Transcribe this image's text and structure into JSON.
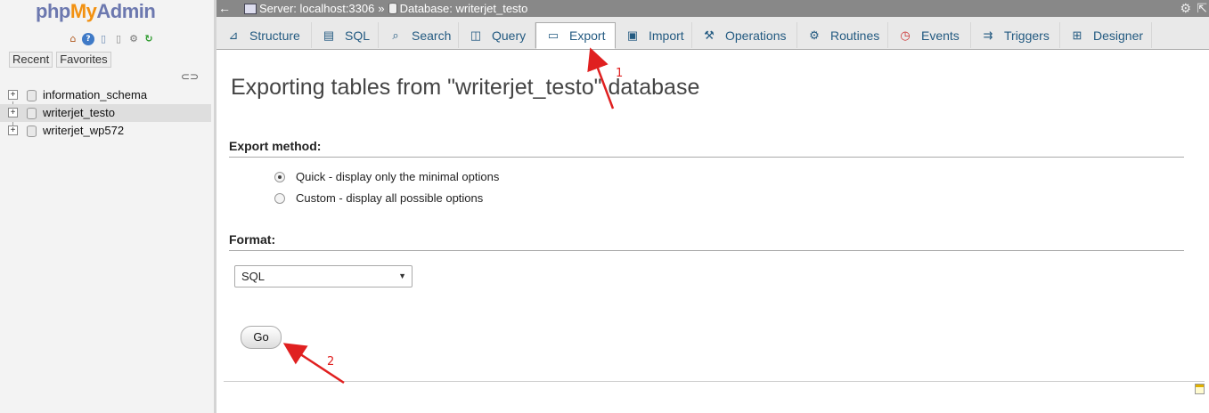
{
  "sidebar": {
    "logo": {
      "php": "php",
      "my": "My",
      "admin": "Admin"
    },
    "icons": [
      "home-icon",
      "help-icon",
      "docs-icon",
      "sql-docs-icon",
      "settings-icon",
      "reload-icon"
    ],
    "tabs": {
      "recent": "Recent",
      "favorites": "Favorites"
    },
    "databases": [
      {
        "name": "information_schema",
        "selected": false
      },
      {
        "name": "writerjet_testo",
        "selected": true
      },
      {
        "name": "writerjet_wp572",
        "selected": false
      }
    ]
  },
  "topbar": {
    "server": "Server: localhost:3306",
    "separator": "»",
    "database": "Database: writerjet_testo"
  },
  "tabs": [
    {
      "label": "Structure",
      "icon": "structure-icon",
      "active": false
    },
    {
      "label": "SQL",
      "icon": "sql-icon",
      "active": false
    },
    {
      "label": "Search",
      "icon": "search-icon",
      "active": false
    },
    {
      "label": "Query",
      "icon": "query-icon",
      "active": false
    },
    {
      "label": "Export",
      "icon": "export-icon",
      "active": true
    },
    {
      "label": "Import",
      "icon": "import-icon",
      "active": false
    },
    {
      "label": "Operations",
      "icon": "wrench-icon",
      "active": false
    },
    {
      "label": "Routines",
      "icon": "routines-icon",
      "active": false
    },
    {
      "label": "Events",
      "icon": "clock-icon",
      "active": false
    },
    {
      "label": "Triggers",
      "icon": "triggers-icon",
      "active": false
    },
    {
      "label": "Designer",
      "icon": "designer-icon",
      "active": false
    }
  ],
  "main": {
    "title": "Exporting tables from \"writerjet_testo\" database",
    "export_method": {
      "heading": "Export method:",
      "options": [
        {
          "label": "Quick - display only the minimal options",
          "checked": true
        },
        {
          "label": "Custom - display all possible options",
          "checked": false
        }
      ]
    },
    "format": {
      "heading": "Format:",
      "selected": "SQL"
    },
    "go_label": "Go"
  },
  "annotations": {
    "step1": "1",
    "step2": "2",
    "color": "#e02020"
  },
  "colors": {
    "link": "#235a81",
    "topbar": "#888888",
    "sidebar": "#f3f3f3"
  }
}
